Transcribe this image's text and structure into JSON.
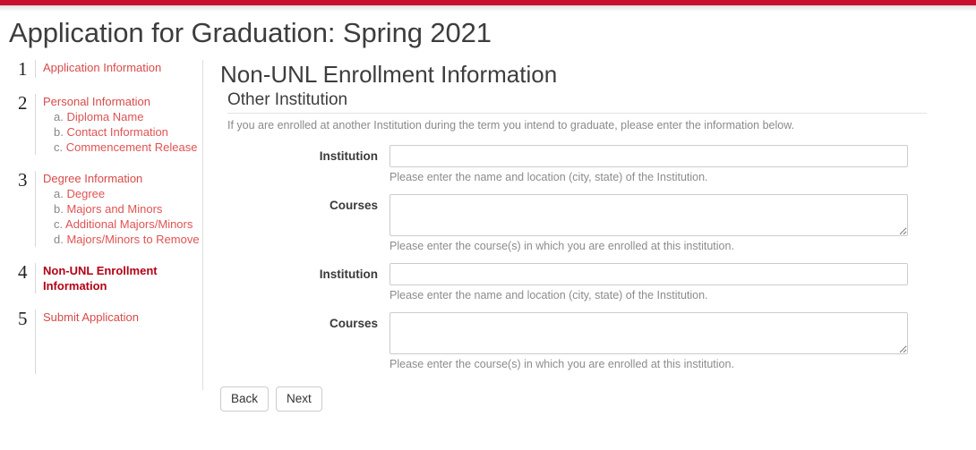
{
  "theme": {
    "brand_red": "#c8102e",
    "link_red": "#d94a4a",
    "active_red": "#b30116",
    "text_dark": "#3d3d3d",
    "help_gray": "#8a8a8a"
  },
  "header": {
    "title": "Application for Graduation: Spring 2021"
  },
  "sidebar": {
    "steps": [
      {
        "number": "1",
        "label": "Application Information",
        "active": false,
        "subitems": []
      },
      {
        "number": "2",
        "label": "Personal Information",
        "active": false,
        "subitems": [
          {
            "marker": "a.",
            "label": "Diploma Name"
          },
          {
            "marker": "b.",
            "label": "Contact Information"
          },
          {
            "marker": "c.",
            "label": "Commencement Release"
          }
        ]
      },
      {
        "number": "3",
        "label": "Degree Information",
        "active": false,
        "subitems": [
          {
            "marker": "a.",
            "label": "Degree"
          },
          {
            "marker": "b.",
            "label": "Majors and Minors"
          },
          {
            "marker": "c.",
            "label": "Additional Majors/Minors"
          },
          {
            "marker": "d.",
            "label": "Majors/Minors to Remove"
          }
        ]
      },
      {
        "number": "4",
        "label": "Non-UNL Enrollment Information",
        "active": true,
        "subitems": []
      },
      {
        "number": "5",
        "label": "Submit Application",
        "active": false,
        "subitems": []
      }
    ]
  },
  "main": {
    "heading": "Non-UNL Enrollment Information",
    "section_heading": "Other Institution",
    "section_description": "If you are enrolled at another Institution during the term you intend to graduate, please enter the information below.",
    "fields": [
      {
        "label": "Institution",
        "type": "text",
        "value": "",
        "placeholder": "",
        "help": "Please enter the name and location (city, state) of the Institution."
      },
      {
        "label": "Courses",
        "type": "textarea",
        "value": "",
        "placeholder": "",
        "help": "Please enter the course(s) in which you are enrolled at this institution."
      },
      {
        "label": "Institution",
        "type": "text",
        "value": "",
        "placeholder": "",
        "help": "Please enter the name and location (city, state) of the Institution."
      },
      {
        "label": "Courses",
        "type": "textarea",
        "value": "",
        "placeholder": "",
        "help": "Please enter the course(s) in which you are enrolled at this institution."
      }
    ],
    "buttons": {
      "back": "Back",
      "next": "Next"
    }
  }
}
